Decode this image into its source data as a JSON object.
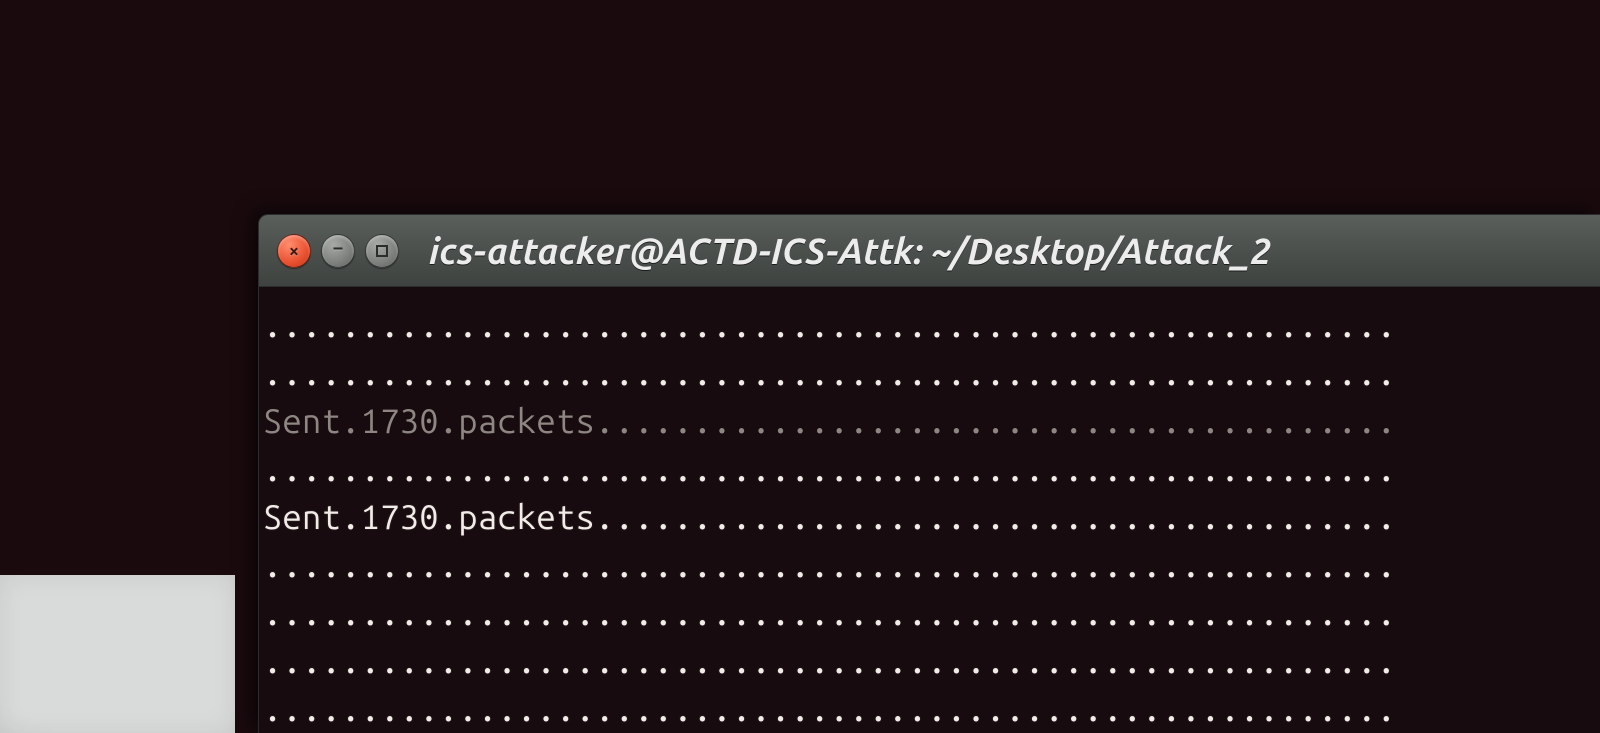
{
  "window": {
    "title": "ics-attacker@ACTD-ICS-Attk: ~/Desktop/Attack_2",
    "buttons": {
      "close": "×",
      "minimize": "–"
    }
  },
  "terminal": {
    "lines": [
      {
        "text": "..........................................................",
        "dim": false
      },
      {
        "text": "..........................................................",
        "dim": false
      },
      {
        "text": "Sent.1730.packets.........................................",
        "dim": true
      },
      {
        "text": "..........................................................",
        "dim": false
      },
      {
        "text": "Sent.1730.packets.........................................",
        "dim": false
      },
      {
        "text": "..........................................................",
        "dim": false
      },
      {
        "text": "..........................................................",
        "dim": false
      },
      {
        "text": "..........................................................",
        "dim": false
      },
      {
        "text": "..........................................................",
        "dim": false
      }
    ]
  }
}
